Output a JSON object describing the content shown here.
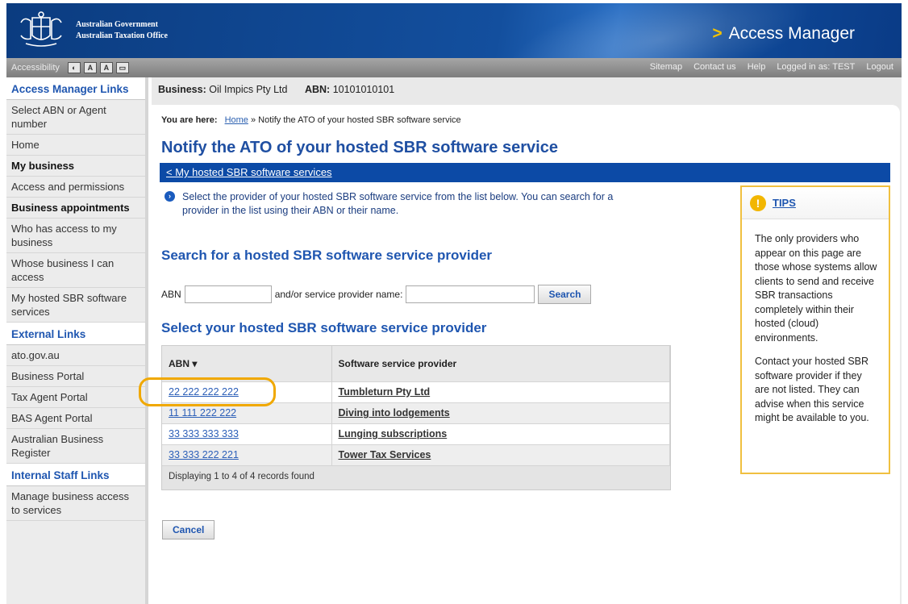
{
  "header": {
    "gov_line1": "Australian Government",
    "gov_line2": "Australian Taxation Office",
    "app_name": "Access Manager",
    "chevron": ">"
  },
  "utility": {
    "accessibility_label": "Accessibility",
    "text_buttons": [
      "◐",
      "A",
      "A",
      "▭"
    ],
    "links": [
      "Sitemap",
      "Contact us",
      "Help",
      "Logged in as: TEST",
      "Logout"
    ]
  },
  "nav": {
    "section1_heading": "Access Manager Links",
    "section1_items": [
      {
        "label": "Select ABN or Agent number",
        "bold": false
      },
      {
        "label": "Home",
        "bold": false
      },
      {
        "label": "My business",
        "bold": true
      },
      {
        "label": "Access and permissions",
        "bold": false
      },
      {
        "label": "Business appointments",
        "bold": true
      },
      {
        "label": "Who has access to my business",
        "bold": false
      },
      {
        "label": "Whose business I can access",
        "bold": false
      },
      {
        "label": "My hosted SBR software services",
        "bold": false
      }
    ],
    "section2_heading": "External Links",
    "section2_items": [
      "ato.gov.au",
      "Business Portal",
      "Tax Agent Portal",
      "BAS Agent Portal",
      "Australian Business Register"
    ],
    "section3_heading": "Internal Staff Links",
    "section3_items": [
      "Manage business access to services"
    ]
  },
  "business": {
    "label": "Business:",
    "name": "Oil Impics Pty Ltd",
    "abn_label": "ABN:",
    "abn": "10101010101"
  },
  "breadcrumb": {
    "prefix": "You are here:",
    "home": "Home",
    "separator": "»",
    "current": "Notify the ATO of your hosted SBR software service"
  },
  "page": {
    "title": "Notify the ATO of your hosted SBR software service",
    "back_link": "< My hosted SBR software services",
    "info_text": "Select the provider of your hosted SBR software service from the list below. You can search for a provider in the list using their ABN or their name.",
    "search_heading": "Search for a hosted SBR software service provider",
    "select_heading": "Select your hosted SBR software service provider",
    "cancel_label": "Cancel"
  },
  "search": {
    "abn_label": "ABN",
    "abn_value": "",
    "name_label": "and/or service provider name:",
    "name_value": "",
    "button_label": "Search"
  },
  "table": {
    "col_abn": "ABN",
    "sort_glyph": "▾",
    "col_provider": "Software service provider",
    "rows": [
      {
        "abn": "22 222 222 222",
        "provider": "Tumbleturn Pty Ltd"
      },
      {
        "abn": "11 111 222 222",
        "provider": "Diving into lodgements"
      },
      {
        "abn": "33 333 333 333",
        "provider": "Lunging subscriptions"
      },
      {
        "abn": "33 333 222 221",
        "provider": "Tower Tax Services"
      }
    ],
    "footer": "Displaying 1 to 4 of 4 records found"
  },
  "tips": {
    "icon": "!",
    "title": "TIPS",
    "para1": "The only providers who appear on this page are those whose systems allow clients to send and receive SBR transactions completely within their hosted (cloud) environments.",
    "para2": "Contact your hosted SBR software provider if they are not listed. They can advise when this service might be available to you."
  },
  "colors": {
    "brand_blue": "#0c4aa6",
    "heading_blue": "#1f56b0",
    "highlight_orange": "#f0a800",
    "tips_border": "#f0c040"
  }
}
